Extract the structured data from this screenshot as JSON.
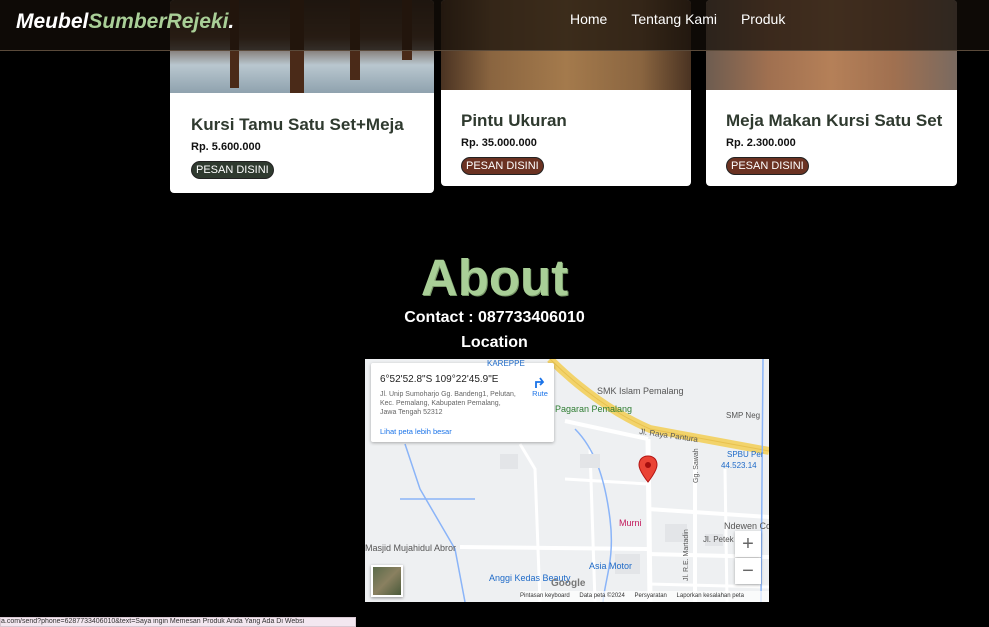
{
  "navbar": {
    "brand_main": "Meubel",
    "brand_accent": "SumberRejeki",
    "brand_dot": ".",
    "links": [
      "Home",
      "Tentang Kami",
      "Produk"
    ]
  },
  "products": [
    {
      "title": "Kursi Tamu Satu Set+Meja",
      "price": "Rp. 5.600.000",
      "button": "PESAN DISINI",
      "button_color": "#2f3a2f"
    },
    {
      "title": "Pintu Ukuran",
      "price": "Rp. 35.000.000",
      "button": "PESAN DISINI",
      "button_color": "#6b3222"
    },
    {
      "title": "Meja Makan Kursi Satu Set",
      "price": "Rp. 2.300.000",
      "button": "PESAN DISINI",
      "button_color": "#6b3222"
    }
  ],
  "about": {
    "title": "About",
    "contact": "Contact : 087733406010",
    "location": "Location"
  },
  "map": {
    "coordinates": "6°52'52.8\"S 109°22'45.9\"E",
    "address": "Jl. Unip Sumoharjo Gg. Bandeng1, Pelutan, Kec. Pemalang, Kabupaten Pemalang, Jawa Tengah 52312",
    "route_label": "Rute",
    "bigger_map_link": "Lihat peta lebih besar",
    "labels": {
      "karepp": "KAREPPE",
      "smk": "SMK Islam Pemalang",
      "pagaran": "Pagaran Pemalang",
      "smp": "SMP Neg",
      "jl_raya": "Jl. Raya Pantura",
      "spbu": "SPBU Per",
      "spbu_num": "44.523.14",
      "gg_sawah": "Gg. Sawah",
      "murni": "Murni",
      "ndewen": "Ndewen Co",
      "masjid": "Masjid Mujahidul Abror",
      "jl_petek": "Jl. Petek",
      "jl_martadin": "Jl. R.E. Martadin",
      "asia_motor": "Asia Motor",
      "anggi": "Anggi Kedas Beauty"
    },
    "zoom_in": "+",
    "zoom_out": "−",
    "google": "Google",
    "footer": [
      "Pintasan keyboard",
      "Data peta ©2024",
      "Persyaratan",
      "Laporkan kesalahan peta"
    ]
  },
  "status_url": "a.com/send?phone=6287733406010&text=Saya ingin Memesan Produk Anda Yang Ada Di Websi"
}
